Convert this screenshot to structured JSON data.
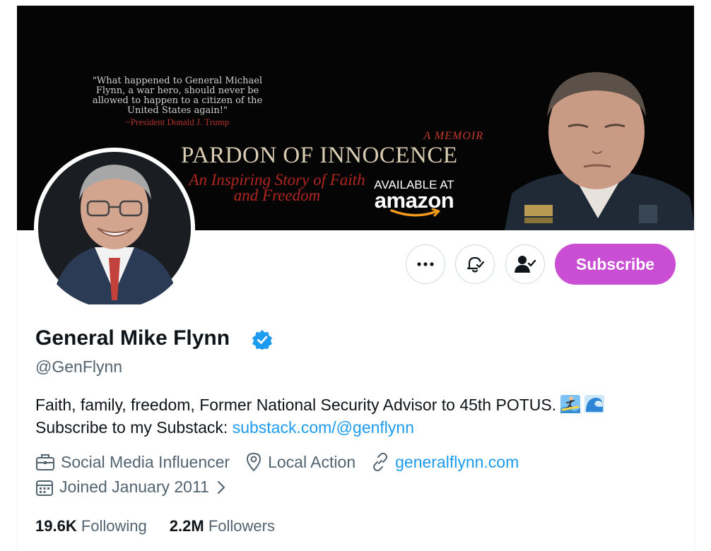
{
  "banner": {
    "quote": "\"What happened to General Michael Flynn, a war hero, should never be allowed to happen to a citizen of the United States again!\"",
    "quote_attribution": "~President Donald J. Trump",
    "memoir_label": "A MEMOIR",
    "book_title": "PARDON OF INNOCENCE",
    "tagline": "An Inspiring Story of Faith and Freedom",
    "available_at": "AVAILABLE AT",
    "store": "amazon"
  },
  "profile": {
    "display_name": "General Mike Flynn",
    "handle": "@GenFlynn",
    "bio_line1": "Faith, family, freedom, Former National Security Advisor to 45th POTUS.",
    "bio_line2_prefix": "Subscribe to my Substack:",
    "bio_link": "substack.com/@genflynn",
    "bio_emojis": [
      "surfer-emoji",
      "wave-emoji"
    ],
    "category": "Social Media Influencer",
    "location": "Local Action",
    "website": "generalflynn.com",
    "joined": "Joined January 2011"
  },
  "actions": {
    "subscribe_label": "Subscribe",
    "more_icon": "more-icon",
    "notify_icon": "bell-icon",
    "follow_icon": "following-person-icon"
  },
  "stats": {
    "following_count": "19.6K",
    "following_label": "Following",
    "followers_count": "2.2M",
    "followers_label": "Followers"
  },
  "colors": {
    "subscribe_bg": "#c94ed3",
    "link": "#1d9bf0",
    "verified": "#1d9bf0",
    "secondary_text": "#536471",
    "primary_text": "#0f1419"
  }
}
